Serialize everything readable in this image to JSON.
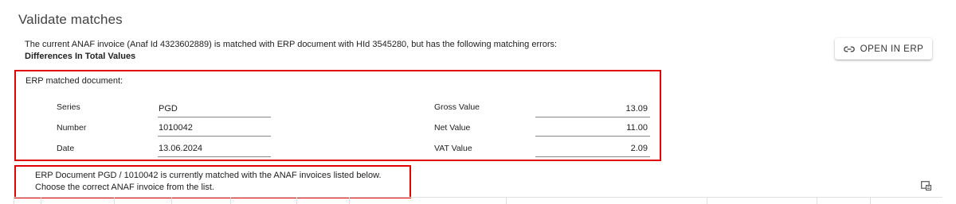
{
  "page": {
    "title": "Validate matches"
  },
  "info": {
    "message": "The current ANAF invoice (Anaf Id 4323602889) is matched with ERP document with HId 3545280, but has the following matching errors:",
    "errors": "Differences In Total Values"
  },
  "actions": {
    "open_in_erp_label": "OPEN IN ERP",
    "open_in_erp_icon": "link-icon"
  },
  "erp_document": {
    "label": "ERP matched document:",
    "series_label": "Series",
    "series_value": "PGD",
    "number_label": "Number",
    "number_value": "1010042",
    "date_label": "Date",
    "date_value": "13.06.2024",
    "gross_label": "Gross Value",
    "gross_value": "13.09",
    "net_label": "Net Value",
    "net_value": "11.00",
    "vat_label": "VAT Value",
    "vat_value": "2.09"
  },
  "note": {
    "line1": "ERP Document PGD / 1010042 is currently matched with the ANAF invoices listed below.",
    "line2": "Choose the correct ANAF invoice from the list."
  },
  "table": {
    "settings_icon": "column-settings-icon"
  },
  "colors": {
    "highlight_border": "#e00000",
    "text": "#212121",
    "title": "#424242",
    "underline": "#8a8a8a"
  }
}
